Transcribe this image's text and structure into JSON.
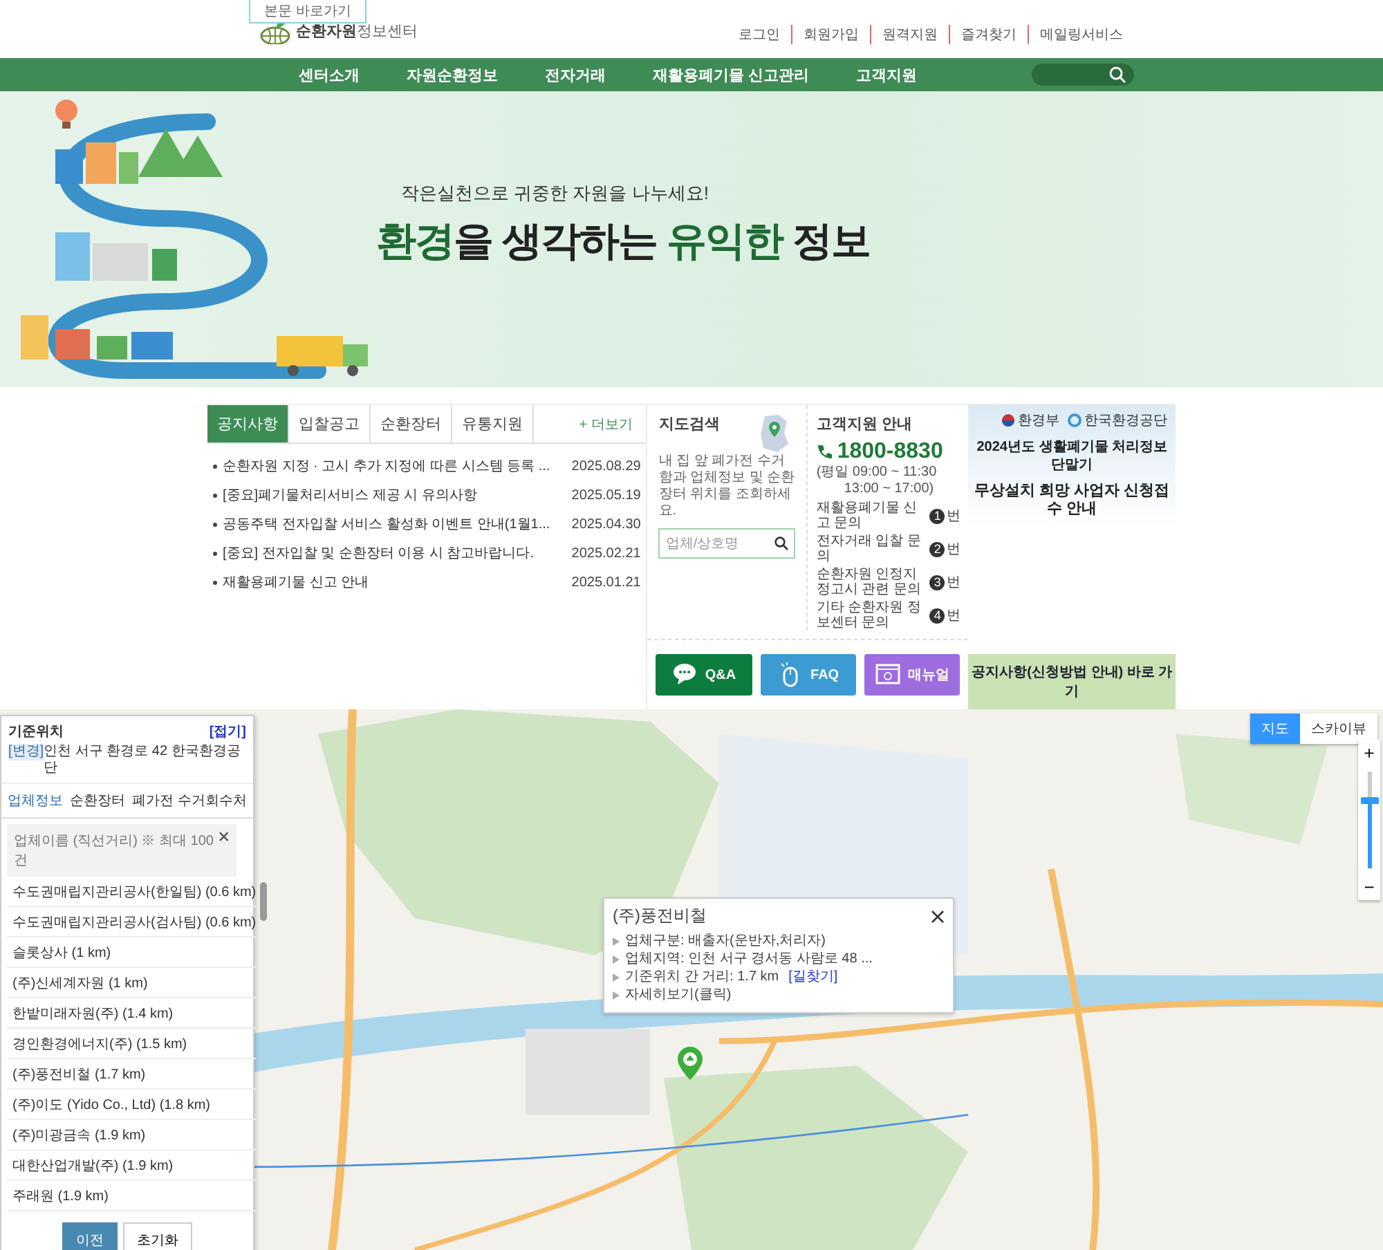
{
  "header": {
    "skip_link": "본문 바로가기",
    "logo_main": "순환자원",
    "logo_sub": "정보센터",
    "util_links": [
      "로그인",
      "회원가입",
      "원격지원",
      "즐겨찾기",
      "메일링서비스"
    ]
  },
  "nav": {
    "items": [
      "센터소개",
      "자원순환정보",
      "전자거래",
      "재활용폐기물 신고관리",
      "고객지원"
    ]
  },
  "hero": {
    "tagline": "작은실천으로 귀중한 자원을 나누세요!",
    "headline": "**환경**을 생각하는 **유익한** 정보"
  },
  "notices": {
    "tabs": [
      {
        "label": "공지사항",
        "selected": true
      },
      {
        "label": "입찰공고",
        "selected": false
      },
      {
        "label": "순환장터",
        "selected": false
      },
      {
        "label": "유통지원",
        "selected": false
      }
    ],
    "more": "+ 더보기",
    "items": [
      {
        "title": "순환자원 지정 · 고시 추가 지정에 따른 시스템 등록 ...",
        "date": "2025.08.29"
      },
      {
        "title": "[중요]폐기물처리서비스 제공 시 유의사항",
        "date": "2025.05.19"
      },
      {
        "title": "공동주택 전자입찰 서비스 활성화 이벤트 안내(1월1...",
        "date": "2025.04.30"
      },
      {
        "title": "[중요] 전자입찰 및 순환장터 이용 시 참고바랍니다.",
        "date": "2025.02.21"
      },
      {
        "title": "재활용폐기물 신고 안내",
        "date": "2025.01.21"
      }
    ]
  },
  "map_search": {
    "title": "지도검색",
    "description": "내 집 앞 폐가전 수거함과 업체정보 및 순환장터 위치를 조회하세요.",
    "placeholder": "업체/상호명"
  },
  "support": {
    "title": "고객지원 안내",
    "phone": "1800-8830",
    "hours": [
      "(평일 09:00 ~ 11:30",
      "13:00 ~ 17:00)"
    ],
    "lines": [
      {
        "label": "재활용폐기물 신고 문의",
        "number": "1",
        "unit": "번"
      },
      {
        "label": "전자거래 입찰 문의",
        "number": "2",
        "unit": "번"
      },
      {
        "label": "순환자원 인정지정고시 관련 문의",
        "number": "3",
        "unit": "번"
      },
      {
        "label": "기타 순환자원 정보센터 문의",
        "number": "4",
        "unit": "번"
      }
    ]
  },
  "quick_buttons": [
    {
      "label": "Q&A",
      "kind": "qna"
    },
    {
      "label": "FAQ",
      "kind": "faq"
    },
    {
      "label": "매뉴얼",
      "kind": "manual"
    }
  ],
  "promo": {
    "logos": [
      "환경부",
      "한국환경공단"
    ],
    "title_lines": [
      "2024년도 생활폐기물 처리정보 단말기",
      "무상설치 희망 사업자 신청접수 안내"
    ],
    "button": "공지사항(신청방법 안내) 바로 가기"
  },
  "map": {
    "panel": {
      "title": "기준위치",
      "fold": "[접기]",
      "change": "[변경]",
      "address": "인천 서구 환경로 42 한국환경공단",
      "tabs": [
        {
          "label": "업체정보",
          "selected": true
        },
        {
          "label": "순환장터",
          "selected": false
        },
        {
          "label": "폐가전 수거회수처",
          "selected": false
        }
      ],
      "list_header": "업체이름 (직선거리) ※ 최대 100건",
      "results": [
        "수도권매립지관리공사(한일팀) (0.6 km)",
        "수도권매립지관리공사(검사팀) (0.6 km)",
        "슬롯상사 (1 km)",
        "(주)신세계자원 (1 km)",
        "한밭미래자원(주) (1.4 km)",
        "경인환경에너지(주) (1.5 km)",
        "(주)풍전비철 (1.7 km)",
        "(주)이도 (Yido Co., Ltd) (1.8 km)",
        "(주)미광금속 (1.9 km)",
        "대한산업개발(주) (1.9 km)",
        "주래원 (1.9 km)"
      ],
      "buttons": [
        "이전",
        "초기화"
      ]
    },
    "popup": {
      "title": "(주)풍전비철",
      "lines": [
        "업체구분: 배출자(운반자,처리자)",
        "업체지역: 인천 서구 경서동 사람로 48 ...",
        "기준위치 간 거리: 1.7 km",
        "자세히보기(클릭)"
      ],
      "link": "[길찾기]"
    },
    "map_types": [
      {
        "label": "지도",
        "selected": true
      },
      {
        "label": "스카이뷰",
        "selected": false
      }
    ],
    "zoom": {
      "plus": "+",
      "minus": "−",
      "level": 0.7
    }
  }
}
